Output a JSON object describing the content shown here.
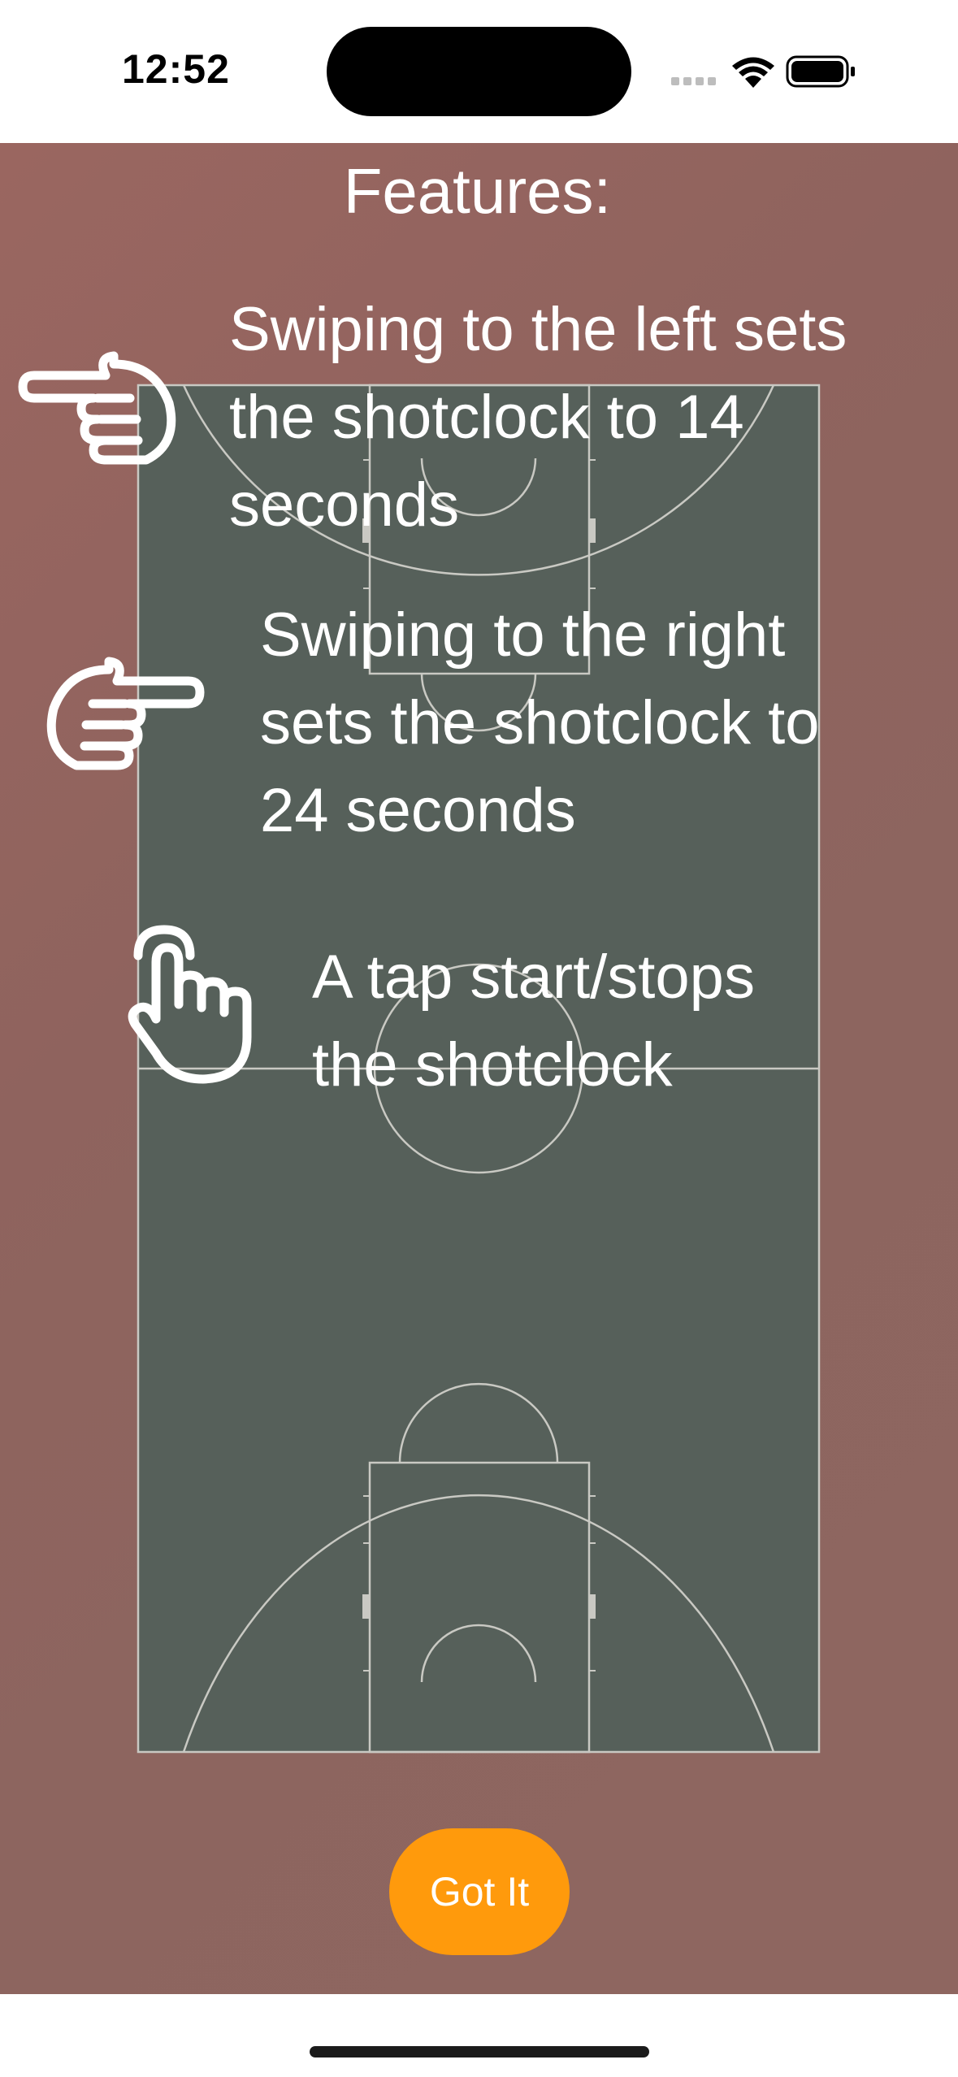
{
  "status_bar": {
    "time": "12:52"
  },
  "onboarding": {
    "title": "Features:",
    "features": [
      {
        "text": "Swiping to the left sets\nthe shotclock to 14\nseconds",
        "icon": "hand-pointing-left-icon"
      },
      {
        "text": "Swiping to the right\nsets the shotclock to\n24 seconds",
        "icon": "hand-pointing-right-icon"
      },
      {
        "text": "A tap start/stops\nthe shotclock",
        "icon": "hand-tap-icon"
      }
    ],
    "button_label": "Got It"
  },
  "colors": {
    "background": "#8f635e",
    "court": "#56605a",
    "court_lines": "#c9c9c3",
    "button": "#ff9a0c",
    "text": "#ffffff"
  }
}
